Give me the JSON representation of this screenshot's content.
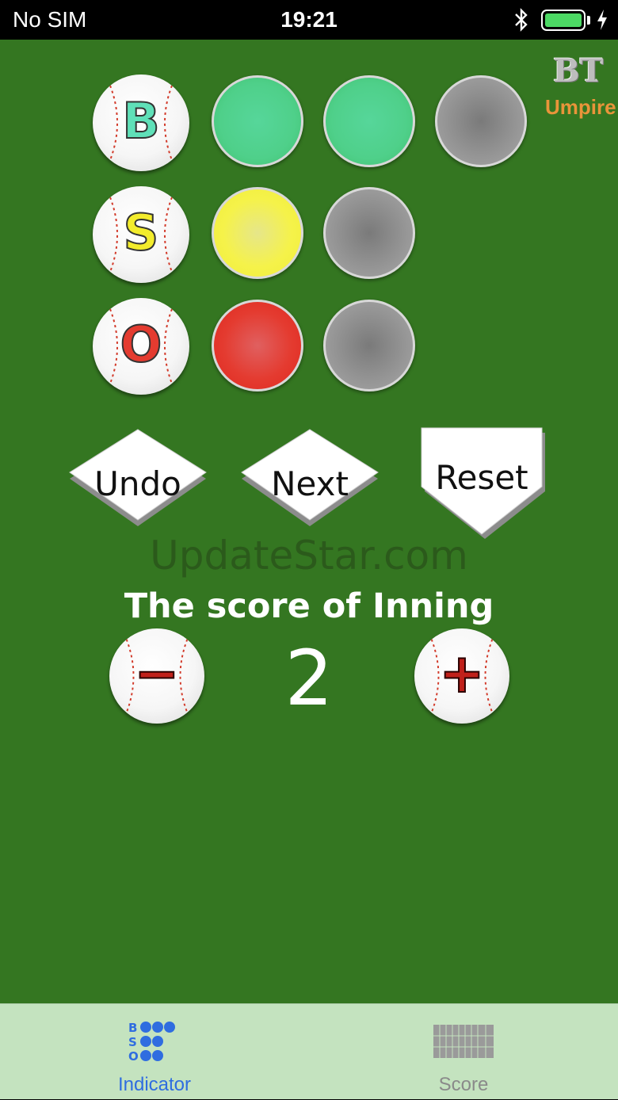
{
  "status_bar": {
    "carrier": "No SIM",
    "time": "19:21",
    "battery_color": "#4cd964"
  },
  "logo": {
    "bt": "BT",
    "umpire": "Umpire"
  },
  "indicator": {
    "ball_letter": "B",
    "strike_letter": "S",
    "out_letter": "O",
    "balls_lit": 2,
    "balls_total": 3,
    "strikes_lit": 1,
    "strikes_total": 2,
    "outs_lit": 1,
    "outs_total": 2,
    "colors": {
      "ball": "#4fd08a",
      "strike": "#f5f24a",
      "out": "#e43b30",
      "off": "#969696"
    }
  },
  "buttons": {
    "undo": "Undo",
    "next": "Next",
    "reset": "Reset"
  },
  "watermark": "UpdateStar.com",
  "score": {
    "title": "The score of Inning",
    "value": "2",
    "minus": "−",
    "plus": "+"
  },
  "tabbar": {
    "tabs": [
      {
        "label": "Indicator",
        "icon": "bso-indicator-icon",
        "active": true
      },
      {
        "label": "Score",
        "icon": "scoreboard-icon",
        "active": false
      }
    ],
    "active_color": "#2f6de0",
    "inactive_color": "#8a8a8a"
  },
  "colors": {
    "field": "#347621",
    "tabbar_bg": "#c4e3bf"
  }
}
